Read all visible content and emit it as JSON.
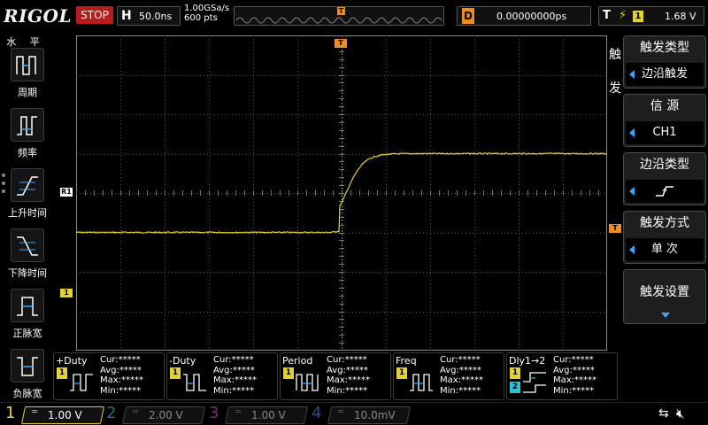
{
  "topbar": {
    "logo": "RIGOL",
    "run_state": "STOP",
    "timebase_label": "H",
    "timebase_value": "50.0ns",
    "sample_rate": "1.00GSa/s",
    "memory_depth": "600  pts",
    "trigger_pos_marker": "T",
    "delay_label": "D",
    "delay_value": "0.00000000ps",
    "trigger_label": "T",
    "trigger_edge_icon": "rising-edge-icon",
    "trigger_source": "1",
    "trigger_level": "1.68 V"
  },
  "left_menu": {
    "title": "水 平",
    "items": [
      {
        "label": "周期",
        "icon": "period-icon"
      },
      {
        "label": "频率",
        "icon": "frequency-icon"
      },
      {
        "label": "上升时间",
        "icon": "rise-time-icon"
      },
      {
        "label": "下降时间",
        "icon": "fall-time-icon"
      },
      {
        "label": "正脉宽",
        "icon": "positive-width-icon"
      },
      {
        "label": "负脉宽",
        "icon": "negative-width-icon"
      }
    ]
  },
  "scope": {
    "ref_marker": "R1",
    "ch1_marker": "1",
    "trig_level_marker": "T",
    "trig_time_marker": "T"
  },
  "right_menu": {
    "tab_char_1": "触",
    "tab_char_2": "发",
    "trigger_type": {
      "caption": "触发类型",
      "value": "边沿触发"
    },
    "source": {
      "caption": "信 源",
      "value": "CH1"
    },
    "edge_type": {
      "caption": "边沿类型",
      "value": "rising-edge-icon"
    },
    "sweep": {
      "caption": "触发方式",
      "value": "单 次"
    },
    "settings": {
      "caption": "触发设置"
    }
  },
  "measurements": [
    {
      "title": "+Duty",
      "channel": "1",
      "cur": "Cur:*****",
      "avg": "Avg:*****",
      "max": "Max:*****",
      "min": "Min:*****"
    },
    {
      "title": "-Duty",
      "channel": "1",
      "cur": "Cur:*****",
      "avg": "Avg:*****",
      "max": "Max:*****",
      "min": "Min:*****"
    },
    {
      "title": "Period",
      "channel": "1",
      "cur": "Cur:*****",
      "avg": "Avg:*****",
      "max": "Max:*****",
      "min": "Min:*****"
    },
    {
      "title": "Freq",
      "channel": "1",
      "cur": "Cur:*****",
      "avg": "Avg:*****",
      "max": "Max:*****",
      "min": "Min:*****"
    },
    {
      "title": "Dly1→2",
      "channel": "1",
      "channel2": "2",
      "cur": "Cur:*****",
      "avg": "Avg:*****",
      "max": "Max:*****",
      "min": "Min:*****"
    }
  ],
  "channels": [
    {
      "num": "1",
      "coupling": "═",
      "scale": "1.00 V",
      "color": "#e6d22e",
      "active": true
    },
    {
      "num": "2",
      "coupling": "═",
      "scale": "2.00 V",
      "color": "#22c6d8",
      "active": false
    },
    {
      "num": "3",
      "coupling": "═",
      "scale": "1.00 V",
      "color": "#d040d0",
      "active": false
    },
    {
      "num": "4",
      "coupling": "═",
      "scale": "10.0mV",
      "color": "#3a6ee0",
      "active": false
    }
  ],
  "status_icons": {
    "usb": "usb-icon",
    "speaker": "mute-icon"
  },
  "colors": {
    "ch1": "#e6d22e",
    "ch2": "#22c6d8",
    "trigger": "#f08c20",
    "stop": "#b81c1c",
    "accent": "#3aa8ff"
  },
  "waveform": {
    "time_per_div_ns": 50,
    "volts_per_div": 1.0,
    "low_level_div": -1.0,
    "high_level_div": 1.0,
    "edge_center_div": 0,
    "rise_time_div": 0.8
  }
}
